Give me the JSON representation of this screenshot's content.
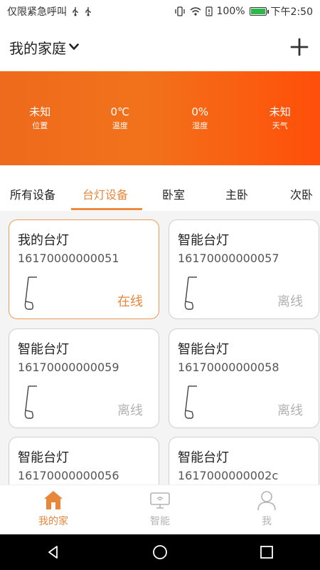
{
  "status_bar": {
    "carrier": "仅限紧急呼叫",
    "battery": "100%",
    "time": "下午2:50",
    "battery_color": "#2fb84a"
  },
  "header": {
    "family_name": "我的家庭"
  },
  "banner": {
    "stats": [
      {
        "value": "未知",
        "label": "位置"
      },
      {
        "value": "0℃",
        "label": "温度"
      },
      {
        "value": "0%",
        "label": "湿度"
      },
      {
        "value": "未知",
        "label": "天气"
      }
    ],
    "gradient": [
      "#ee6a1c",
      "#ff4f09"
    ]
  },
  "tabs": [
    {
      "label": "所有设备"
    },
    {
      "label": "台灯设备",
      "active": true
    },
    {
      "label": "卧室"
    },
    {
      "label": "主卧"
    },
    {
      "label": "次卧"
    }
  ],
  "devices": [
    {
      "name": "我的台灯",
      "code": "16170000000051",
      "status": "在线",
      "online": true
    },
    {
      "name": "智能台灯",
      "code": "16170000000057",
      "status": "离线",
      "online": false
    },
    {
      "name": "智能台灯",
      "code": "16170000000059",
      "status": "离线",
      "online": false
    },
    {
      "name": "智能台灯",
      "code": "16170000000058",
      "status": "离线",
      "online": false
    },
    {
      "name": "智能台灯",
      "code": "16170000000056",
      "status": "",
      "online": false
    },
    {
      "name": "智能台灯",
      "code": "1617000000002c",
      "status": "",
      "online": false
    }
  ],
  "bottom_nav": [
    {
      "label": "我的家",
      "icon": "home-icon",
      "active": true
    },
    {
      "label": "智能",
      "icon": "smart-icon",
      "active": false
    },
    {
      "label": "我",
      "icon": "profile-icon",
      "active": false
    }
  ],
  "colors": {
    "accent": "#e8863a",
    "offline": "#b2b2b2"
  }
}
